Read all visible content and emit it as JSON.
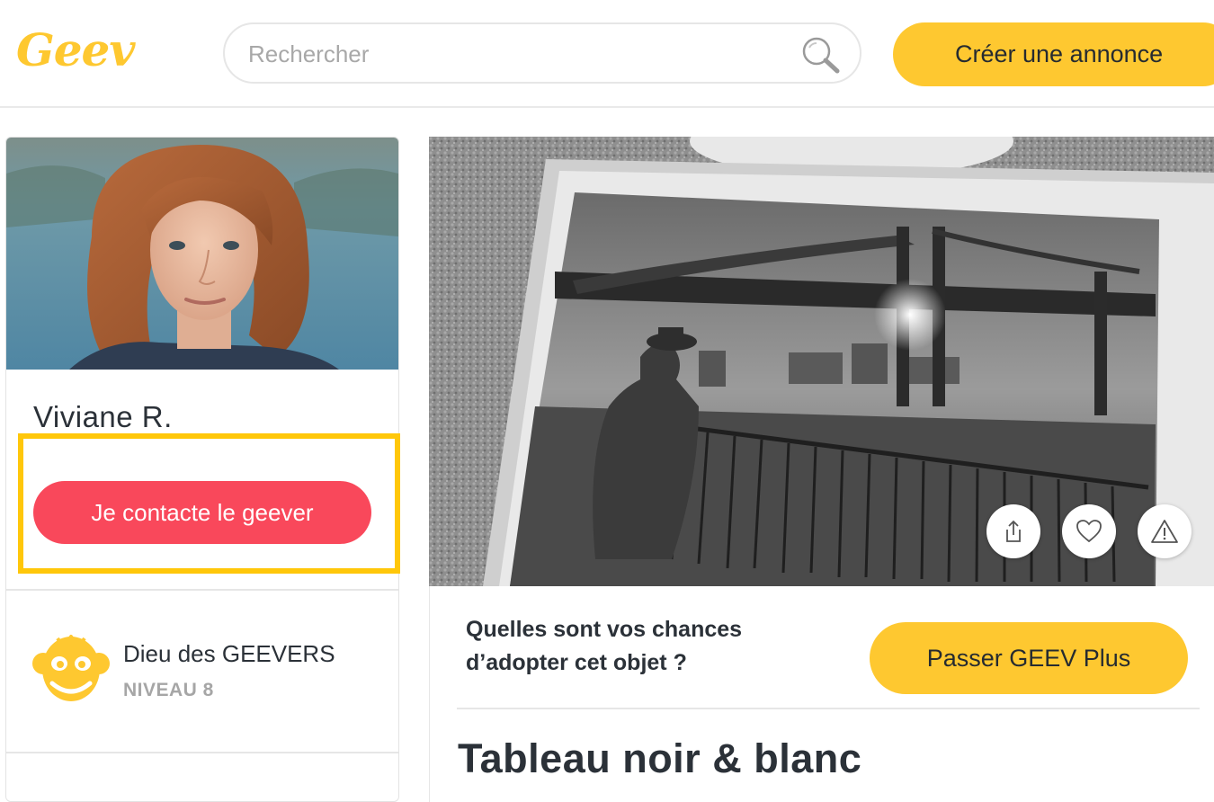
{
  "header": {
    "logo_text": "Geev",
    "search_placeholder": "Rechercher",
    "search_icon": "search-icon",
    "create_label": "Créer une annonce"
  },
  "profile": {
    "name": "Viviane R.",
    "contact_label": "Je contacte le geever",
    "badge": {
      "icon": "monkey-badge-icon",
      "title": "Dieu des GEEVERS",
      "level": "NIVEAU 8"
    }
  },
  "listing": {
    "photo_description_icon": "listing-photo",
    "actions": [
      {
        "name": "share",
        "icon": "share-icon"
      },
      {
        "name": "favorite",
        "icon": "heart-icon"
      },
      {
        "name": "report",
        "icon": "warning-icon"
      }
    ],
    "chances_text": "Quelles sont vos chances d’adopter cet objet ?",
    "geev_plus_label": "Passer GEEV Plus",
    "title": "Tableau noir & blanc"
  },
  "colors": {
    "brand_yellow": "#fec830",
    "contact_red": "#f9485b",
    "highlight_yellow": "#ffc70a",
    "text_dark": "#2b3138",
    "text_muted": "#a6a6a6"
  }
}
